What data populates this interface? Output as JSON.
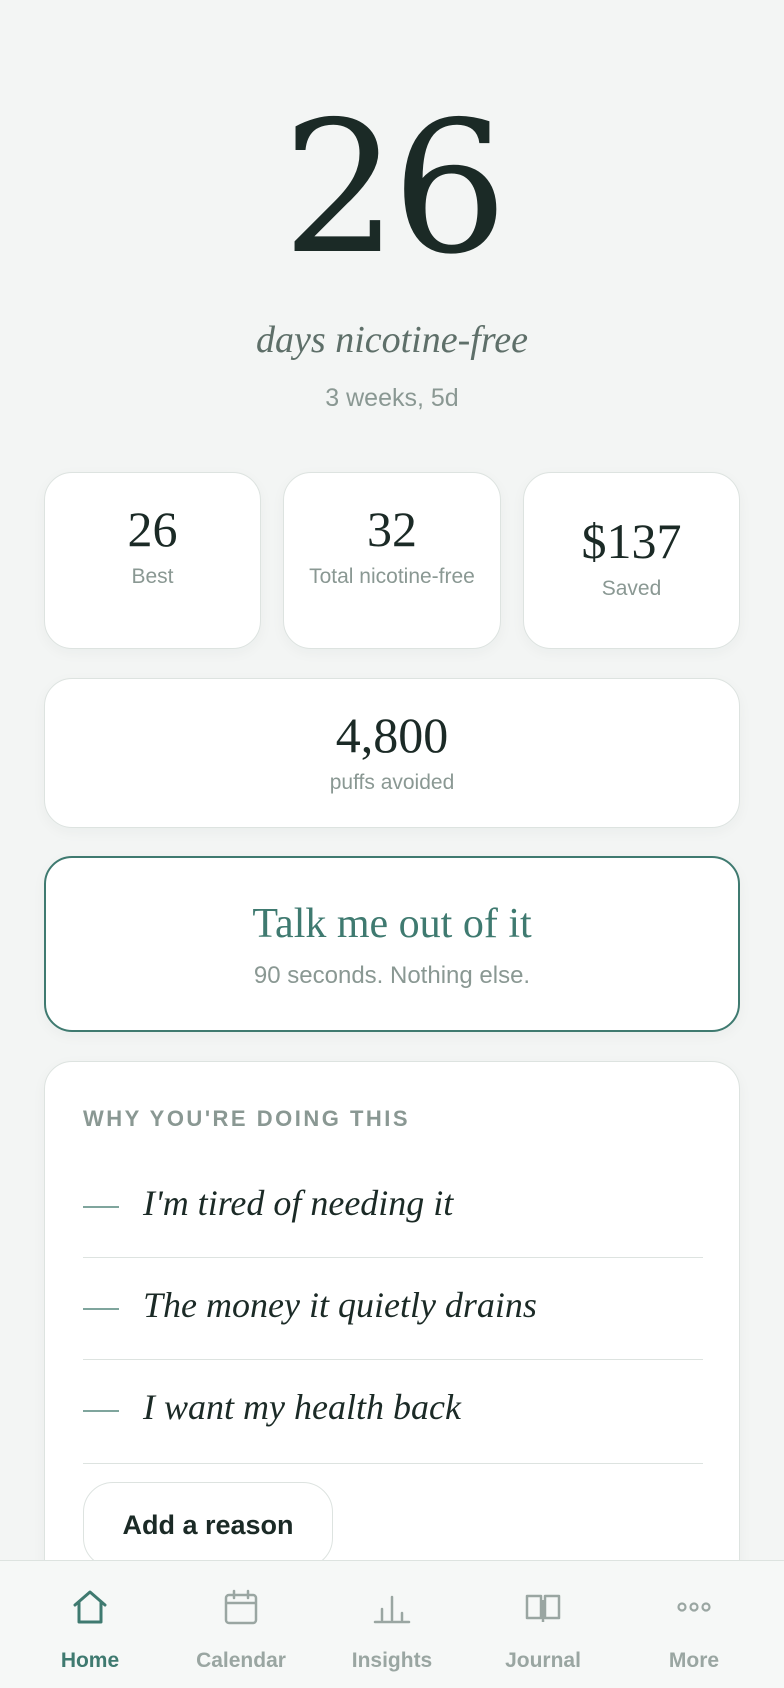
{
  "hero": {
    "days": "26",
    "subtitle": "days nicotine-free",
    "duration": "3 weeks, 5d"
  },
  "stats": [
    {
      "value": "26",
      "label": "Best"
    },
    {
      "value": "32",
      "label": "Total nicotine-free"
    },
    {
      "value": "$137",
      "label": "Saved"
    }
  ],
  "puffs": {
    "value": "4,800",
    "label": "puffs avoided"
  },
  "talk": {
    "title": "Talk me out of it",
    "subtitle": "90 seconds. Nothing else."
  },
  "reasons": {
    "heading": "WHY YOU'RE DOING THIS",
    "items": [
      "I'm tired of needing it",
      "The money it quietly drains",
      "I want my health back"
    ],
    "add_label": "Add a reason"
  },
  "tabs": [
    {
      "label": "Home",
      "icon": "home-icon",
      "active": true
    },
    {
      "label": "Calendar",
      "icon": "calendar-icon",
      "active": false
    },
    {
      "label": "Insights",
      "icon": "insights-icon",
      "active": false
    },
    {
      "label": "Journal",
      "icon": "journal-icon",
      "active": false
    },
    {
      "label": "More",
      "icon": "more-icon",
      "active": false
    }
  ],
  "colors": {
    "accent": "#3f7a70",
    "muted": "#8a9893",
    "text": "#1b2a26",
    "background": "#f3f5f4"
  }
}
